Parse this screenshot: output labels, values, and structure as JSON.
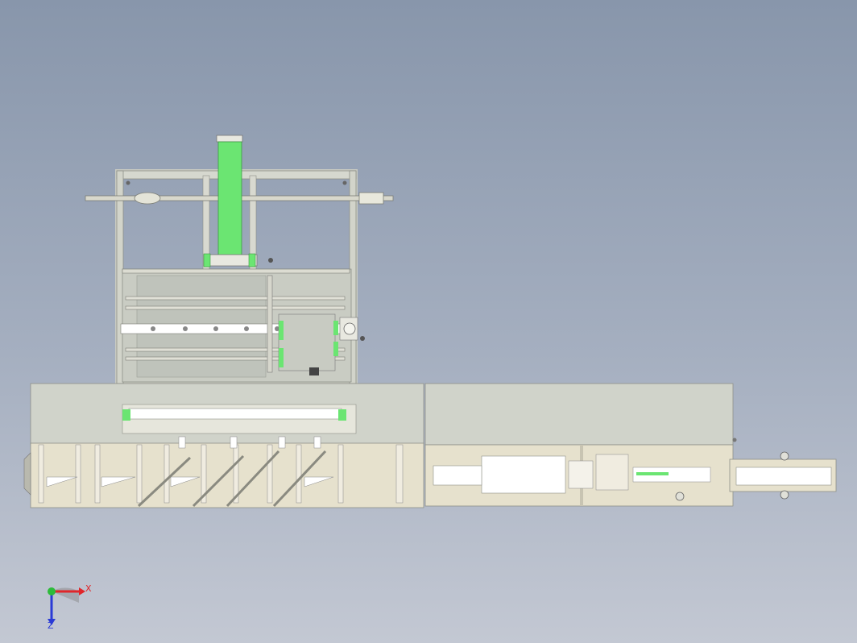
{
  "viewport": {
    "background_top": "#8896ab",
    "background_bottom": "#c3c8d3"
  },
  "model": {
    "frame_color": "#d2d4ca",
    "base_color": "#e6e1cd",
    "cylinder_color": "#66e36e",
    "highlight_color": "#ffffff",
    "dark_part_color": "#555555"
  },
  "triad": {
    "x_label": "X",
    "z_label": "Z",
    "x_color": "#e0262a",
    "y_color": "#2dbb3a",
    "z_color": "#2a3ad6"
  }
}
